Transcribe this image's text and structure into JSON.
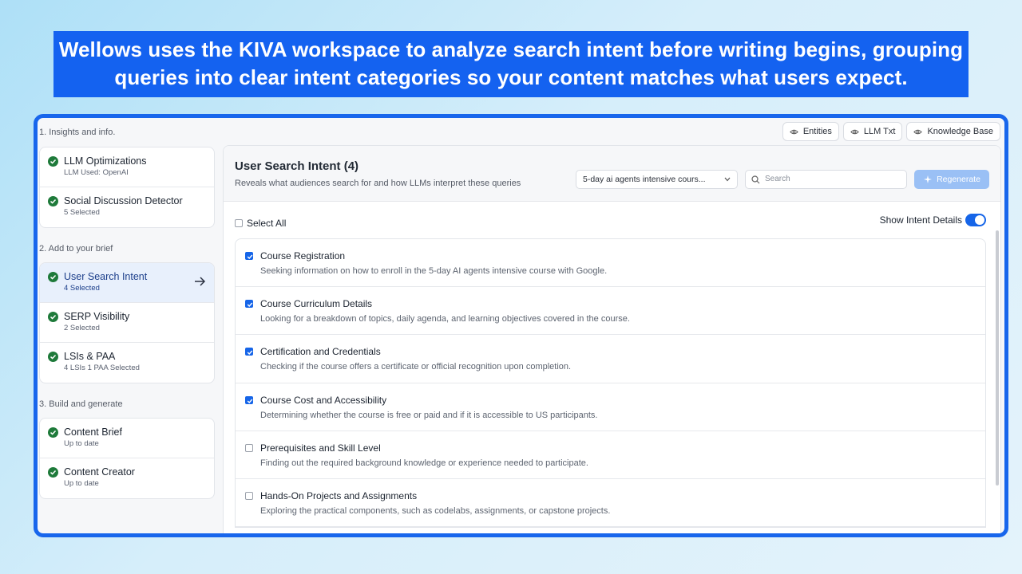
{
  "banner": {
    "line1": "Wellows uses the KIVA workspace to analyze search intent before writing begins, grouping",
    "line2": "queries into clear intent categories so your content matches what users expect."
  },
  "top": {
    "section_label": "1. Insights and info.",
    "buttons": [
      "Entities",
      "LLM Txt",
      "Knowledge Base"
    ]
  },
  "sidebar": {
    "group1": [
      {
        "title": "LLM Optimizations",
        "sub": "LLM Used: OpenAI"
      },
      {
        "title": "Social Discussion Detector",
        "sub": "5 Selected"
      }
    ],
    "section2": "2. Add to your brief",
    "group2": [
      {
        "title": "User Search Intent",
        "sub": "4 Selected"
      },
      {
        "title": "SERP Visibility",
        "sub": "2 Selected"
      },
      {
        "title": "LSIs & PAA",
        "sub": "4 LSIs 1 PAA Selected"
      }
    ],
    "section3": "3. Build and generate",
    "group3": [
      {
        "title": "Content Brief",
        "sub": "Up to date"
      },
      {
        "title": "Content Creator",
        "sub": "Up to date"
      }
    ]
  },
  "main": {
    "title": "User Search Intent (4)",
    "subtitle": "Reveals what audiences search for and how LLMs interpret these queries",
    "select_value": "5-day ai agents intensive cours...",
    "search_placeholder": "Search",
    "regenerate_label": "Regenerate",
    "select_all_label": "Select All",
    "show_details_label": "Show Intent Details",
    "show_details_on": true,
    "intents": [
      {
        "title": "Course Registration",
        "desc": "Seeking information on how to enroll in the 5-day AI agents intensive course with Google.",
        "checked": true
      },
      {
        "title": "Course Curriculum Details",
        "desc": "Looking for a breakdown of topics, daily agenda, and learning objectives covered in the course.",
        "checked": true
      },
      {
        "title": "Certification and Credentials",
        "desc": "Checking if the course offers a certificate or official recognition upon completion.",
        "checked": true
      },
      {
        "title": "Course Cost and Accessibility",
        "desc": "Determining whether the course is free or paid and if it is accessible to US participants.",
        "checked": true
      },
      {
        "title": "Prerequisites and Skill Level",
        "desc": "Finding out the required background knowledge or experience needed to participate.",
        "checked": false
      },
      {
        "title": "Hands-On Projects and Assignments",
        "desc": "Exploring the practical components, such as codelabs, assignments, or capstone projects.",
        "checked": false
      }
    ]
  },
  "colors": {
    "accent": "#1665e8",
    "banner": "#1462f0",
    "success": "#1e7a3a"
  }
}
